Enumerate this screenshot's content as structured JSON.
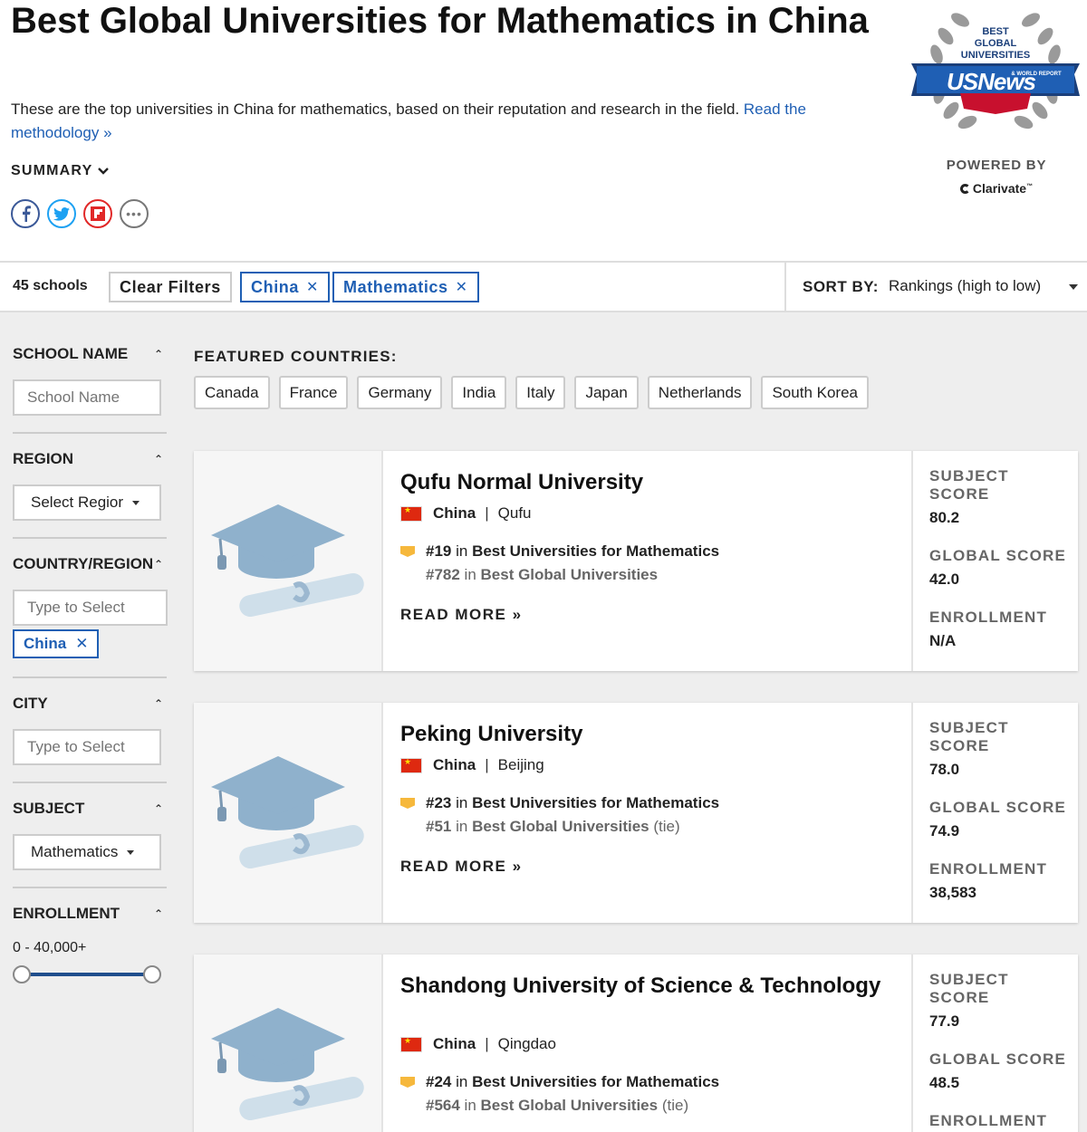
{
  "header": {
    "title": "Best Global Universities for Mathematics in China",
    "intro": "These are the top universities in China for mathematics, based on their reputation and research in the field.",
    "methodology_link": "Read the methodology »",
    "summary_label": "SUMMARY",
    "badge": {
      "line1": "BEST",
      "line2": "GLOBAL",
      "line3": "UNIVERSITIES",
      "brand": "USNews",
      "brand_sub": "& WORLD REPORT"
    },
    "powered_by": "POWERED BY",
    "powered_brand": "Clarivate",
    "social": [
      "facebook-icon",
      "twitter-icon",
      "flipboard-icon",
      "more-icon"
    ]
  },
  "filterbar": {
    "count": "45 schools",
    "clear_filters": "Clear Filters",
    "active_filters": [
      "China",
      "Mathematics"
    ],
    "sort_label": "SORT BY:",
    "sort_value": "Rankings (high to low)"
  },
  "sidebar": {
    "school_name": {
      "heading": "SCHOOL NAME",
      "placeholder": "School Name"
    },
    "region": {
      "heading": "REGION",
      "value": "Select Regior"
    },
    "country": {
      "heading": "COUNTRY/REGION",
      "placeholder": "Type to Select",
      "chip": "China"
    },
    "city": {
      "heading": "CITY",
      "placeholder": "Type to Select"
    },
    "subject": {
      "heading": "SUBJECT",
      "value": "Mathematics"
    },
    "enrollment": {
      "heading": "ENROLLMENT",
      "range": "0 - 40,000+"
    }
  },
  "featured": {
    "heading": "FEATURED COUNTRIES:",
    "countries": [
      "Canada",
      "France",
      "Germany",
      "India",
      "Italy",
      "Japan",
      "Netherlands",
      "South Korea"
    ]
  },
  "schools": [
    {
      "name": "Qufu Normal University",
      "country": "China",
      "city": "Qufu",
      "subject_rank": "#19",
      "subject_rank_label": "Best Universities for Mathematics",
      "global_rank": "#782",
      "global_rank_label": "Best Global Universities",
      "global_tie": "",
      "read_more": "READ MORE »",
      "subject_score_label": "SUBJECT SCORE",
      "subject_score": "80.2",
      "global_score_label": "GLOBAL SCORE",
      "global_score": "42.0",
      "enrollment_label": "ENROLLMENT",
      "enrollment": "N/A"
    },
    {
      "name": "Peking University",
      "country": "China",
      "city": "Beijing",
      "subject_rank": "#23",
      "subject_rank_label": "Best Universities for Mathematics",
      "global_rank": "#51",
      "global_rank_label": "Best Global Universities",
      "global_tie": "(tie)",
      "read_more": "READ MORE »",
      "subject_score_label": "SUBJECT SCORE",
      "subject_score": "78.0",
      "global_score_label": "GLOBAL SCORE",
      "global_score": "74.9",
      "enrollment_label": "ENROLLMENT",
      "enrollment": "38,583"
    },
    {
      "name": "Shandong University of Science & Technology",
      "country": "China",
      "city": "Qingdao",
      "subject_rank": "#24",
      "subject_rank_label": "Best Universities for Mathematics",
      "global_rank": "#564",
      "global_rank_label": "Best Global Universities",
      "global_tie": "(tie)",
      "read_more": "",
      "subject_score_label": "SUBJECT SCORE",
      "subject_score": "77.9",
      "global_score_label": "GLOBAL SCORE",
      "global_score": "48.5",
      "enrollment_label": "ENROLLMENT",
      "enrollment": ""
    }
  ]
}
